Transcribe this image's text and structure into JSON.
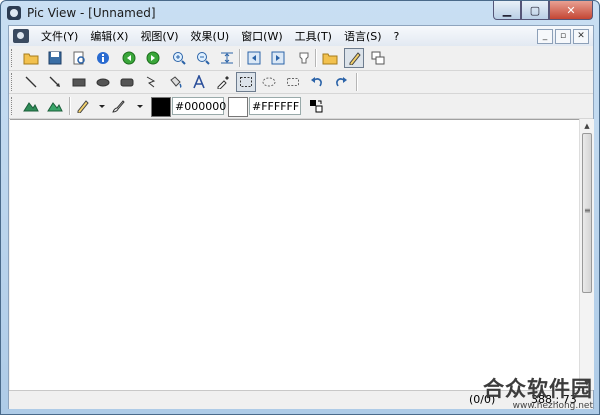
{
  "window": {
    "title": "Pic View - [Unnamed]"
  },
  "menu": {
    "items": [
      "文件(Y)",
      "编辑(X)",
      "视图(V)",
      "效果(U)",
      "窗口(W)",
      "工具(T)",
      "语言(S)",
      "?"
    ]
  },
  "mdi_controls": [
    "_",
    "▫",
    "✕"
  ],
  "colors": {
    "foreground_hex": "#000000",
    "background_hex": "#FFFFFF",
    "foreground": "#000000",
    "background": "#FFFFFF"
  },
  "status": {
    "position": "(0/0)",
    "size": "388 : 73"
  },
  "watermark": {
    "text": "合众软件园",
    "url": "www.hezhong.net"
  }
}
